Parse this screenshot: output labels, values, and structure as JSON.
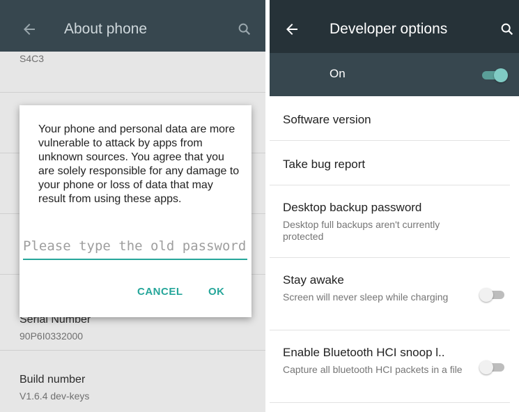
{
  "left": {
    "toolbar": {
      "title": "About phone"
    },
    "items": [
      {
        "sub": "S4C3"
      },
      {
        "title": "Serial Number",
        "sub": "90P6I0332000"
      },
      {
        "title": "Build number",
        "sub": "V1.6.4 dev-keys"
      }
    ],
    "dialog": {
      "message": "Your phone and personal data are more vulnerable to attack by apps from unknown sources. You agree that you are solely responsible for any damage to your phone or loss of data that may result from using these apps.",
      "input_placeholder": "Please type the old password",
      "cancel_label": "CANCEL",
      "ok_label": "OK"
    }
  },
  "right": {
    "toolbar": {
      "title": "Developer options"
    },
    "master": {
      "label": "On",
      "enabled": true
    },
    "items": [
      {
        "title": "Software version"
      },
      {
        "title": "Take bug report"
      },
      {
        "title": "Desktop backup password",
        "sub": "Desktop full backups aren't currently protected"
      },
      {
        "title": "Stay awake",
        "sub": "Screen will never sleep while charging",
        "enabled": false
      },
      {
        "title": "Enable Bluetooth HCI snoop l..",
        "sub": "Capture all bluetooth HCI packets in a file",
        "enabled": false
      }
    ]
  },
  "colors": {
    "accent": "#26a69a",
    "toolbar": "#263238",
    "toolbar_dim": "#37474f"
  },
  "icons": [
    "back-arrow-icon",
    "search-icon"
  ]
}
